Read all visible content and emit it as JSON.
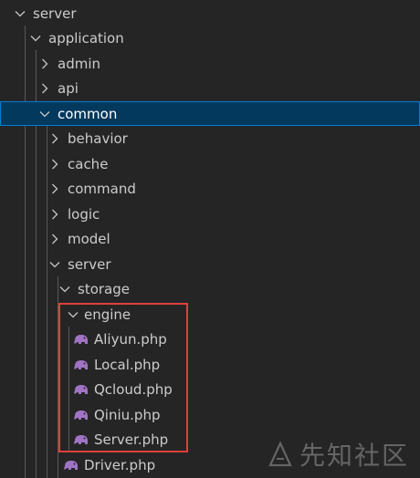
{
  "tree": {
    "server_root": "server",
    "application": "application",
    "admin": "admin",
    "api": "api",
    "common": "common",
    "behavior": "behavior",
    "cache": "cache",
    "command": "command",
    "logic": "logic",
    "model": "model",
    "server": "server",
    "storage": "storage",
    "engine": "engine",
    "aliyun": "Aliyun.php",
    "local": "Local.php",
    "qcloud": "Qcloud.php",
    "qiniu": "Qiniu.php",
    "server_php": "Server.php",
    "driver": "Driver.php"
  },
  "watermark": {
    "text": "先知社区"
  },
  "colors": {
    "background": "#252526",
    "selected_bg": "#04395e",
    "selected_border": "#007fd4",
    "highlight_box": "#e0403a",
    "php_icon": "#a074c4"
  },
  "icons": {
    "expanded": "chevron-down-icon",
    "collapsed": "chevron-right-icon",
    "php_file": "php-elephant-icon"
  }
}
